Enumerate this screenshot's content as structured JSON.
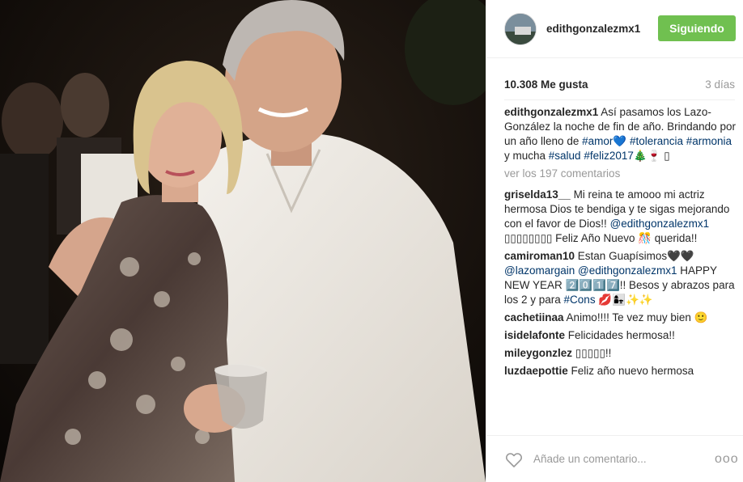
{
  "post": {
    "username": "edithgonzalezmx1",
    "follow_label": "Siguiendo",
    "likes": "10.308 Me gusta",
    "time": "3 días",
    "caption": {
      "user": "edithgonzalezmx1",
      "text1": " Así pasamos los Lazo-González la noche de fin de año. Brindando por un año lleno de ",
      "tag_amor": "#amor",
      "heart": "💙",
      "tag_tolerancia": "#tolerancia",
      "tag_armonia": "#armonia",
      "text2": " y mucha ",
      "tag_salud": "#salud",
      "tag_feliz": "#feliz2017",
      "emojis": "🎄🍷 ▯"
    },
    "view_all": "ver los 197 comentarios",
    "add_comment_placeholder": "Añade un comentario...",
    "more_label": "ooo"
  },
  "comments": [
    {
      "user": "griselda13__",
      "text1": " Mi reina te amooo mi actriz hermosa Dios te bendiga y te sigas mejorando con el favor de Dios!! ",
      "mention": "@edithgonzalezmx1",
      "text2": " ▯▯▯▯▯▯▯▯ Feliz Año Nuevo 🎊 querida!!"
    },
    {
      "user": "camiroman10",
      "text1": " Estan Guapísimos🖤🖤",
      "mention1": "@lazomargain",
      "mention2": "@edithgonzalezmx1",
      "text2": " HAPPY NEW YEAR 2️⃣0️⃣1️⃣7️⃣!! Besos y abrazos para los 2 y para ",
      "tag": "#Cons",
      "text3": " 💋👩‍👧✨✨"
    },
    {
      "user": "cachetiinaa",
      "text": " Animo!!!! Te vez muy bien 🙂"
    },
    {
      "user": "isidelafonte",
      "text": " Felicidades hermosa!!"
    },
    {
      "user": "mileygonzlez",
      "text": " ▯▯▯▯▯!!"
    },
    {
      "user": "luzdaepottie",
      "text": " Feliz año nuevo hermosa"
    }
  ],
  "icons": {
    "heart": "heart-outline-icon",
    "more": "more-options-icon"
  },
  "colors": {
    "follow_button": "#70c050",
    "link": "#003569",
    "muted": "#999999",
    "text": "#262626"
  }
}
